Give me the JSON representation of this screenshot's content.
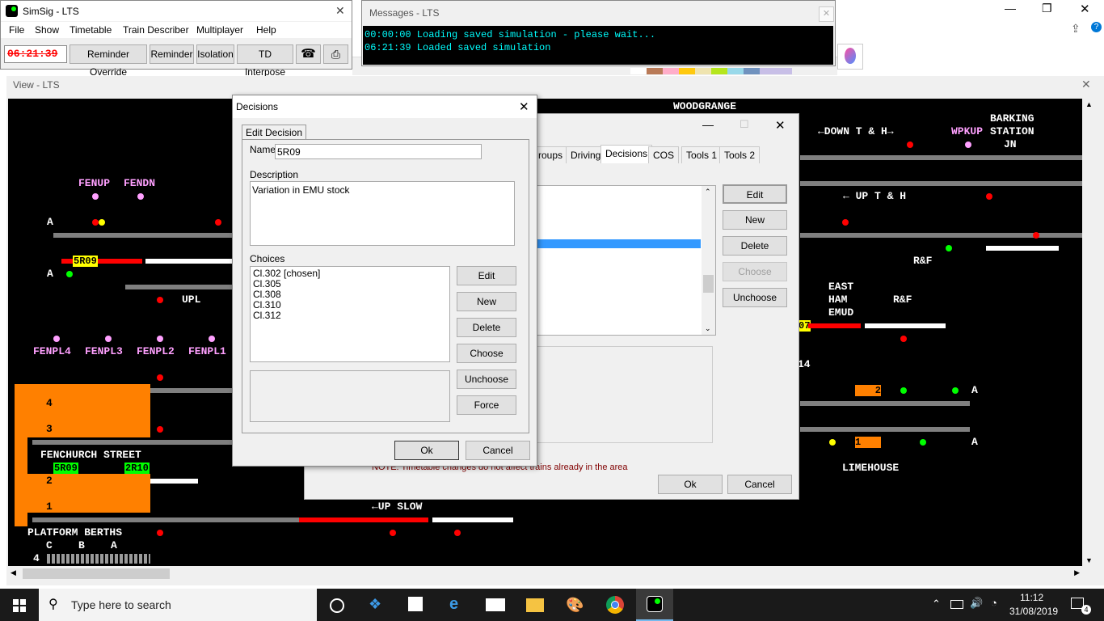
{
  "simsig": {
    "title": "SimSig - LTS",
    "menu": [
      "File",
      "Show",
      "Timetable",
      "Train Describer",
      "Multiplayer",
      "Help"
    ],
    "clock": "06:21:39",
    "toolbar": [
      "Reminder Override",
      "Reminder",
      "Isolation",
      "TD Interpose"
    ]
  },
  "messages": {
    "title": "Messages - LTS",
    "lines": [
      "00:00:00 Loading saved simulation - please wait...",
      "06:21:39 Loaded saved simulation"
    ]
  },
  "view": {
    "title": "View - LTS",
    "labels": {
      "woodgrange": "WOODGRANGE",
      "barking": "BARKING",
      "station": "STATION",
      "jn": "JN",
      "down_th": "←DOWN T & H→",
      "wpkup": "WPKUP",
      "up_th": "← UP T & H",
      "fenup": "FENUP",
      "fendn": "FENDN",
      "upl": "UPL",
      "fenpl4": "FENPL4",
      "fenpl3": "FENPL3",
      "fenpl2": "FENPL2",
      "fenpl1": "FENPL1",
      "fenchurch": "FENCHURCH STREET",
      "east": "EAST",
      "ham": "HAM",
      "emud": "EMUD",
      "rf1": "R&F",
      "rf2": "R&F",
      "limehouse": "LIMEHOUSE",
      "up_slow": "←UP SLOW",
      "platform_berths": "PLATFORM BERTHS",
      "berth_c": "C",
      "berth_b": "B",
      "berth_a": "A",
      "berth_4": "4",
      "plat4": "4",
      "plat3": "3",
      "plat2": "2",
      "plat1": "1",
      "a1": "A",
      "a2": "A",
      "a3": "A",
      "a4": "A",
      "num14": "14"
    },
    "berths": {
      "b5r09_top": "5R09",
      "b5r09_plat": "5R09",
      "b2r10": "2R10",
      "b07": "07",
      "b2": "2",
      "b1": "1"
    }
  },
  "timetable_window": {
    "tabs": [
      "roups",
      "Driving",
      "Decisions",
      "COS",
      "Tools 1",
      "Tools 2"
    ],
    "active_tab": "Decisions",
    "buttons": [
      "Edit",
      "New",
      "Delete",
      "Choose",
      "Unchoose"
    ],
    "note": "NOTE: Timetable changes do not affect trains already in the area",
    "ok": "Ok",
    "cancel": "Cancel"
  },
  "decisions": {
    "title": "Decisions",
    "tab": "Edit Decision",
    "name_label": "Name",
    "name_value": "5R09",
    "description_label": "Description",
    "description_value": "Variation in EMU stock",
    "choices_label": "Choices",
    "choices": [
      "Cl.302 [chosen]",
      "Cl.305",
      "Cl.308",
      "Cl.310",
      "Cl.312"
    ],
    "buttons": [
      "Edit",
      "New",
      "Delete",
      "Choose",
      "Unchoose",
      "Force"
    ],
    "ok": "Ok",
    "cancel": "Cancel"
  },
  "taskbar": {
    "search_placeholder": "Type here to search",
    "time": "11:12",
    "date": "31/08/2019",
    "notifications": "4"
  },
  "colors": {
    "accent": "#0078d7",
    "track_white": "#ffffff",
    "track_red": "#ff0000",
    "track_grey": "#7f7f7f",
    "platform_orange": "#ff8000",
    "berth_green": "#00ff00",
    "berth_yellow": "#ffff00",
    "label_pink": "#ffa0ff",
    "message_text": "#00ffff"
  }
}
